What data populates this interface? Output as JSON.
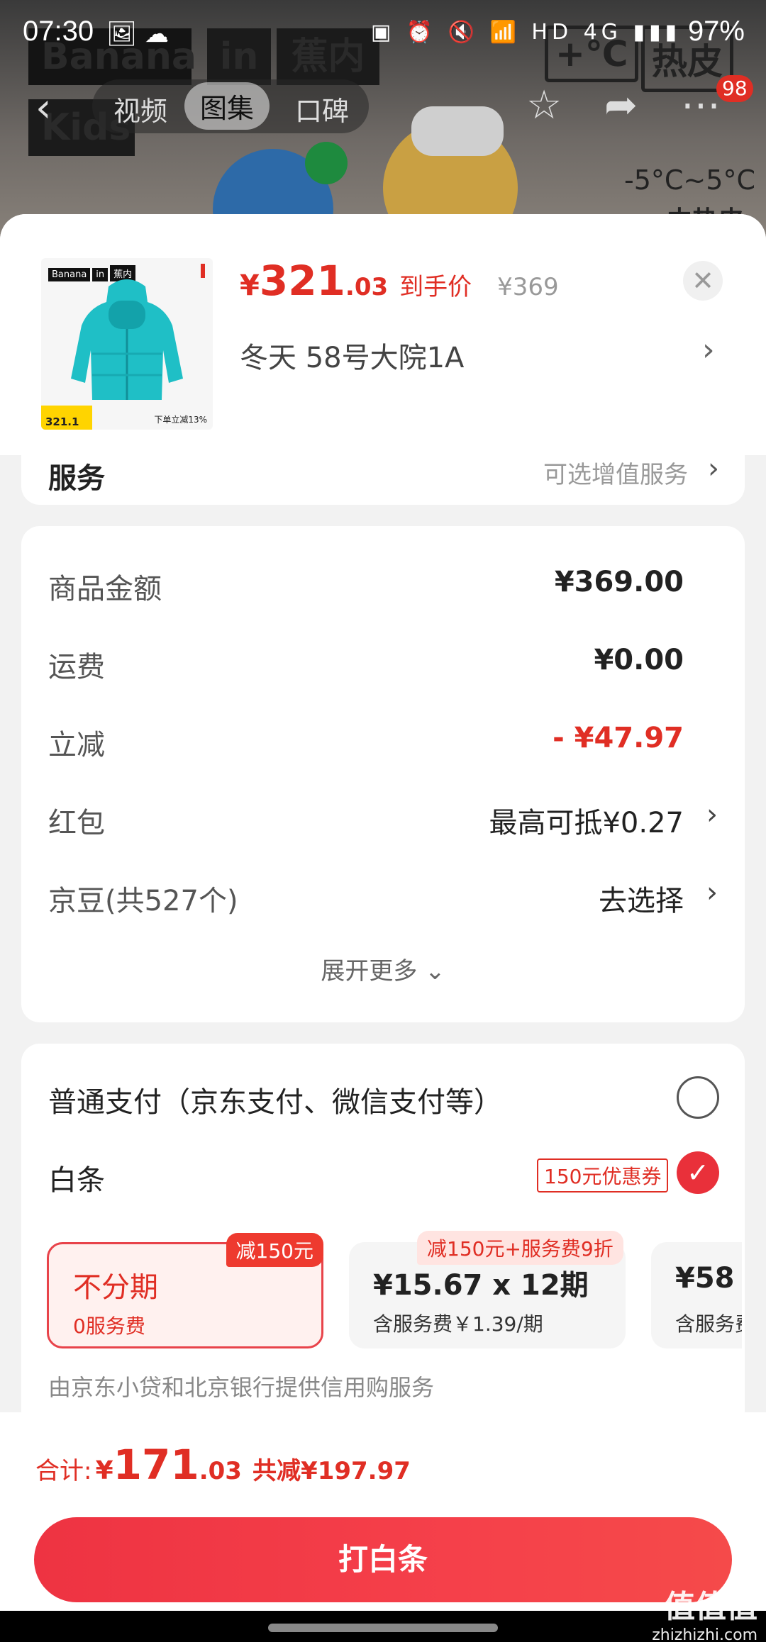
{
  "status_bar": {
    "time": "07:30",
    "battery": "97%",
    "left_icons": "🖼 ☁",
    "right_icons": "▣ ⏰ 🔇 📶 HD 4G ▮▮▮"
  },
  "background": {
    "brand_words": [
      "Banana",
      "in",
      "蕉内",
      "Kids"
    ],
    "tabs": [
      "视频",
      "图集",
      "口碑"
    ],
    "active_tab": "图集",
    "message_badge": "98",
    "temp_tag_1": "+℃",
    "temp_tag_2": "热皮",
    "temp_range": "-5°C~5°C",
    "temp_sub": "中热皮"
  },
  "product": {
    "thumb_brand": [
      "Banana",
      "in",
      "蕉内"
    ],
    "thumb_price": "321.1",
    "thumb_note": "下单立减13%",
    "price_yen": "¥",
    "price_int": "321",
    "price_dec": ".03",
    "price_tag": "到手价",
    "original_price": "¥369",
    "variant": "冬天  58号大院1A"
  },
  "service": {
    "label": "服务",
    "value": "可选增值服务"
  },
  "costs": {
    "rows": [
      {
        "label": "商品金额",
        "value": "¥369.00"
      },
      {
        "label": "运费",
        "value": "¥0.00"
      },
      {
        "label": "立减",
        "value": "- ¥47.97"
      },
      {
        "label": "红包",
        "value": "最高可抵¥0.27"
      },
      {
        "label": "京豆(共527个)",
        "value": "去选择"
      }
    ],
    "expand": "展开更多"
  },
  "payment": {
    "normal_label": "普通支付（京东支付、微信支付等）",
    "baitiao_label": "白条",
    "coupon": "150元优惠券",
    "plans": [
      {
        "main": "不分期",
        "sub": "0服务费",
        "flag": "减150元"
      },
      {
        "main": "¥15.67 x 12期",
        "sub": "含服务费￥1.39/期",
        "flag": "减150元+服务费9折"
      },
      {
        "main": "¥58",
        "sub": "含服务费"
      }
    ],
    "credit_note": "由京东小贷和北京银行提供信用购服务"
  },
  "footer": {
    "total_label": "合计:",
    "total_yen": "¥",
    "total_int": "171",
    "total_dec": ".03",
    "total_save": "共减¥197.97",
    "button": "打白条"
  },
  "watermark": {
    "logo": "值值值",
    "site": "zhizhizhi.com"
  },
  "colors": {
    "accent": "#e02e24",
    "button": "#f0404a"
  }
}
